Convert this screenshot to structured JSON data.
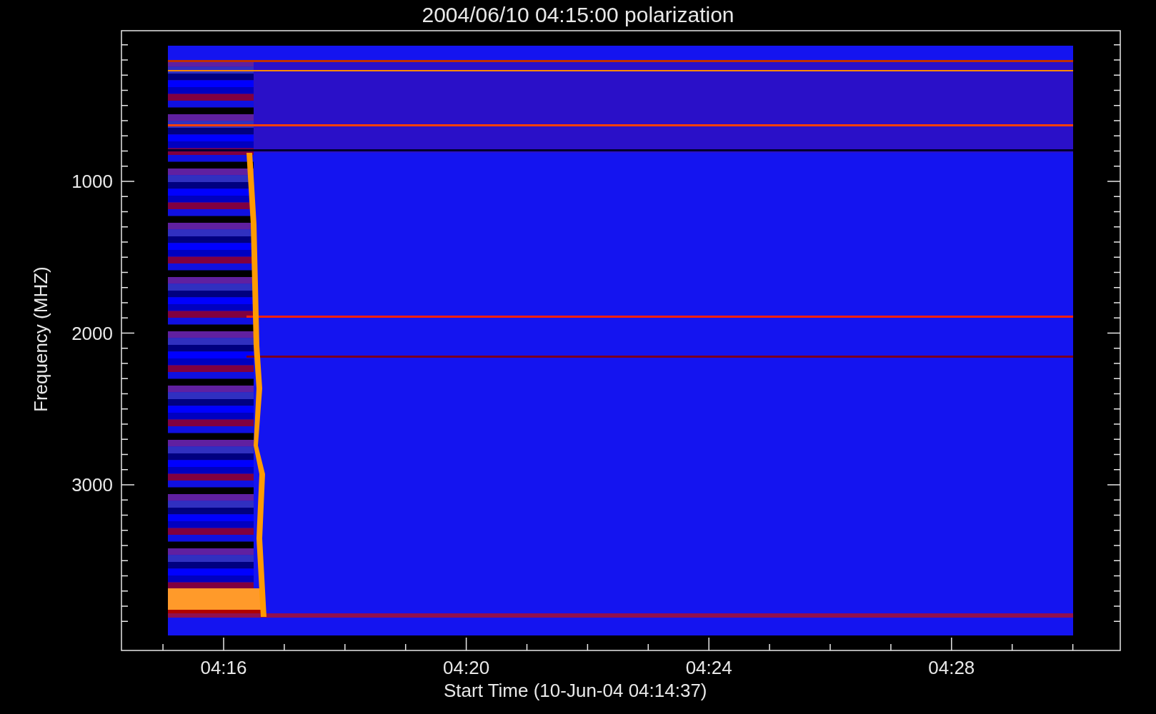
{
  "title": "2004/06/10 04:15:00 polarization",
  "y_axis": {
    "label": "Frequency (MHZ)",
    "tick_labels": [
      "1000",
      "2000",
      "3000"
    ]
  },
  "x_axis": {
    "label": "Start Time (10-Jun-04 04:14:37)",
    "tick_labels": [
      "04:16",
      "04:20",
      "04:24",
      "04:28"
    ]
  }
}
